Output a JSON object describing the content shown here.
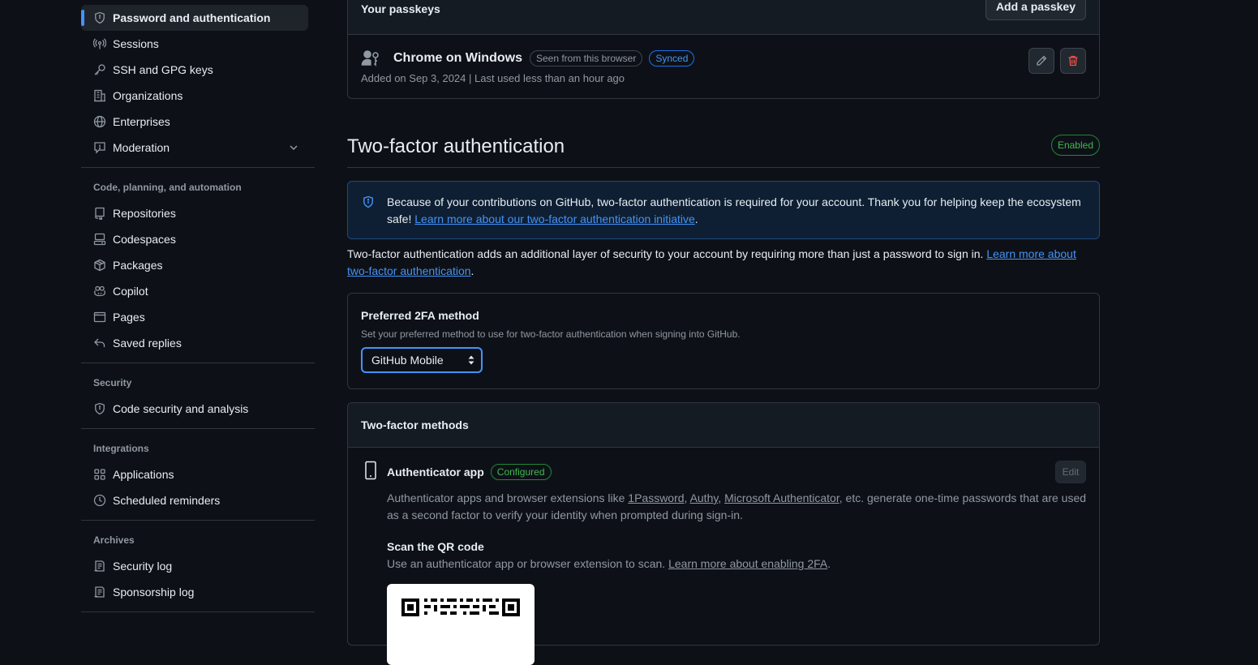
{
  "sidebar": {
    "access_items": [
      {
        "label": "Password and authentication",
        "icon": "shield-lock-icon",
        "active": true
      },
      {
        "label": "Sessions",
        "icon": "broadcast-icon"
      },
      {
        "label": "SSH and GPG keys",
        "icon": "key-icon"
      },
      {
        "label": "Organizations",
        "icon": "organization-icon"
      },
      {
        "label": "Enterprises",
        "icon": "globe-icon"
      },
      {
        "label": "Moderation",
        "icon": "report-icon"
      }
    ],
    "code_heading": "Code, planning, and automation",
    "code_items": [
      {
        "label": "Repositories",
        "icon": "repo-icon"
      },
      {
        "label": "Codespaces",
        "icon": "codespaces-icon"
      },
      {
        "label": "Packages",
        "icon": "package-icon"
      },
      {
        "label": "Copilot",
        "icon": "copilot-icon"
      },
      {
        "label": "Pages",
        "icon": "browser-icon"
      },
      {
        "label": "Saved replies",
        "icon": "reply-icon"
      }
    ],
    "security_heading": "Security",
    "security_items": [
      {
        "label": "Code security and analysis",
        "icon": "shield-lock-icon"
      }
    ],
    "integrations_heading": "Integrations",
    "integrations_items": [
      {
        "label": "Applications",
        "icon": "apps-icon"
      },
      {
        "label": "Scheduled reminders",
        "icon": "clock-icon"
      }
    ],
    "archives_heading": "Archives",
    "archives_items": [
      {
        "label": "Security log",
        "icon": "log-icon"
      },
      {
        "label": "Sponsorship log",
        "icon": "log-icon"
      }
    ]
  },
  "passkeys": {
    "title": "Your passkeys",
    "add_button": "Add a passkey",
    "item": {
      "name": "Chrome on Windows",
      "badge_seen": "Seen from this browser",
      "badge_synced": "Synced",
      "meta": "Added on Sep 3, 2024 | Last used less than an hour ago"
    }
  },
  "two_factor": {
    "title": "Two-factor authentication",
    "status": "Enabled",
    "flash_text": "Because of your contributions on GitHub, two-factor authentication is required for your account. Thank you for helping keep the ecosystem safe! ",
    "flash_link": "Learn more about our two-factor authentication initiative",
    "flash_end": ".",
    "desc_text": "Two-factor authentication adds an additional layer of security to your account by requiring more than just a password to sign in. ",
    "desc_link": "Learn more about two-factor authentication",
    "desc_end": ".",
    "preferred": {
      "title": "Preferred 2FA method",
      "subtitle": "Set your preferred method to use for two-factor authentication when signing into GitHub.",
      "selected": "GitHub Mobile"
    },
    "methods": {
      "title": "Two-factor methods",
      "authenticator": {
        "title": "Authenticator app",
        "badge": "Configured",
        "edit": "Edit",
        "desc_pre": "Authenticator apps and browser extensions like ",
        "link1": "1Password",
        "sep1": ", ",
        "link2": "Authy",
        "sep2": ", ",
        "link3": "Microsoft Authenticator",
        "desc_post": ", etc. generate one-time passwords that are used as a second factor to verify your identity when prompted during sign-in.",
        "scan_title": "Scan the QR code",
        "scan_desc": "Use an authenticator app or browser extension to scan. ",
        "scan_link": "Learn more about enabling 2FA",
        "scan_end": "."
      }
    }
  },
  "colors": {
    "background": "#0d1117",
    "accent": "#4493f8",
    "success": "#3fb950",
    "danger": "#f85149"
  }
}
